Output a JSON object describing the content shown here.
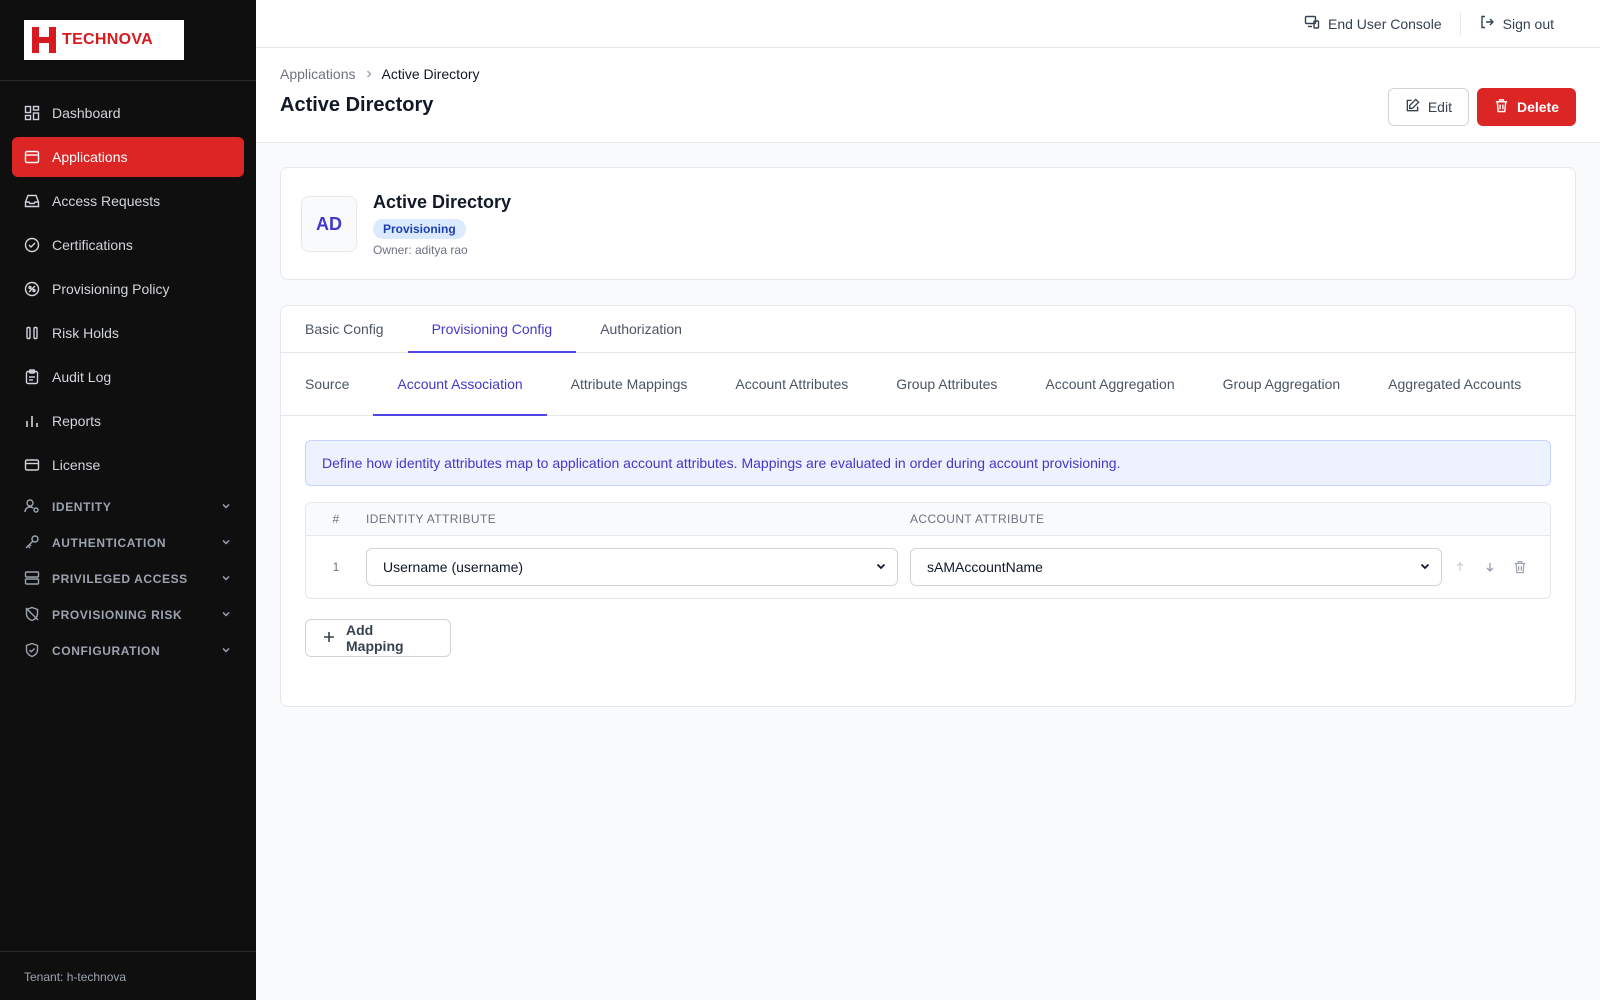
{
  "brand": {
    "name": "TECHNOVA",
    "accent": "#dc2626"
  },
  "sidebar": {
    "items": [
      {
        "label": "Dashboard",
        "icon": "dashboard-icon",
        "active": false
      },
      {
        "label": "Applications",
        "icon": "applications-icon",
        "active": true
      },
      {
        "label": "Access Requests",
        "icon": "inbox-icon",
        "active": false
      },
      {
        "label": "Certifications",
        "icon": "check-circle-icon",
        "active": false
      },
      {
        "label": "Provisioning Policy",
        "icon": "policy-icon",
        "active": false
      },
      {
        "label": "Risk Holds",
        "icon": "pause-icon",
        "active": false
      },
      {
        "label": "Audit Log",
        "icon": "clipboard-icon",
        "active": false
      },
      {
        "label": "Reports",
        "icon": "bar-chart-icon",
        "active": false
      },
      {
        "label": "License",
        "icon": "license-icon",
        "active": false
      }
    ],
    "sections": [
      {
        "label": "IDENTITY",
        "icon": "user-gear-icon"
      },
      {
        "label": "AUTHENTICATION",
        "icon": "key-icon"
      },
      {
        "label": "PRIVILEGED ACCESS",
        "icon": "server-icon"
      },
      {
        "label": "PROVISIONING RISK",
        "icon": "shield-off-icon"
      },
      {
        "label": "CONFIGURATION",
        "icon": "shield-check-icon"
      }
    ],
    "tenant": "Tenant: h-technova"
  },
  "topbar": {
    "console_label": "End User Console",
    "signout_label": "Sign out"
  },
  "header": {
    "breadcrumb": [
      "Applications",
      "Active Directory"
    ],
    "title": "Active Directory",
    "edit_label": "Edit",
    "delete_label": "Delete"
  },
  "app": {
    "initials": "AD",
    "name": "Active Directory",
    "badge": "Provisioning",
    "owner": "Owner: aditya rao"
  },
  "tabs": [
    {
      "label": "Basic Config",
      "active": false
    },
    {
      "label": "Provisioning Config",
      "active": true
    },
    {
      "label": "Authorization",
      "active": false
    }
  ],
  "subtabs": [
    {
      "label": "Source",
      "active": false
    },
    {
      "label": "Account Association",
      "active": true
    },
    {
      "label": "Attribute Mappings",
      "active": false
    },
    {
      "label": "Account Attributes",
      "active": false
    },
    {
      "label": "Group Attributes",
      "active": false
    },
    {
      "label": "Account Aggregation",
      "active": false
    },
    {
      "label": "Group Aggregation",
      "active": false
    },
    {
      "label": "Aggregated Accounts",
      "active": false
    }
  ],
  "info_text": "Define how identity attributes map to application account attributes. Mappings are evaluated in order during account provisioning.",
  "mapping_table": {
    "headers": {
      "num": "#",
      "identity": "IDENTITY ATTRIBUTE",
      "account": "ACCOUNT ATTRIBUTE"
    },
    "rows": [
      {
        "num": "1",
        "identity": "Username (username)",
        "account": "sAMAccountName"
      }
    ]
  },
  "add_mapping_label": "Add Mapping"
}
